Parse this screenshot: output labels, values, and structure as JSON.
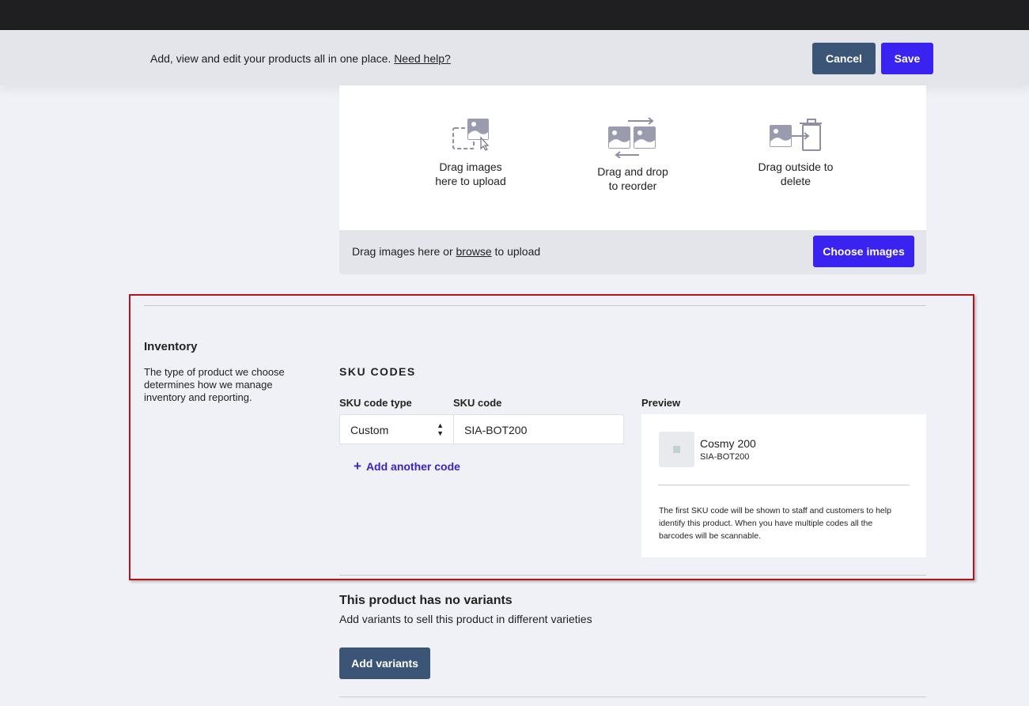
{
  "header": {
    "description": "Add, view and edit your products all in one place.",
    "help_link": "Need help?",
    "cancel_label": "Cancel",
    "save_label": "Save"
  },
  "upload": {
    "items": [
      {
        "icon": "upload-image-icon",
        "line1": "Drag images",
        "line2": "here to upload"
      },
      {
        "icon": "reorder-images-icon",
        "line1": "Drag and drop",
        "line2": "to reorder"
      },
      {
        "icon": "delete-image-icon",
        "line1": "Drag outside to",
        "line2": "delete"
      }
    ],
    "footer_prefix": "Drag images here or",
    "footer_link": "browse",
    "footer_suffix": "to upload",
    "choose_label": "Choose images"
  },
  "inventory": {
    "title": "Inventory",
    "description": "The type of product we choose determines how we manage inventory and reporting."
  },
  "sku": {
    "heading": "SKU CODES",
    "type_label": "SKU code type",
    "code_label": "SKU code",
    "type_value": "Custom",
    "code_value": "SIA-BOT200",
    "add_another_label": "Add another code"
  },
  "preview": {
    "label": "Preview",
    "product_name": "Cosmy 200",
    "product_sku": "SIA-BOT200",
    "note": "The first SKU code will be shown to staff and customers to help identify this product. When you have multiple codes all the barcodes will be scannable."
  },
  "variants": {
    "title": "This product has no variants",
    "description": "Add variants to sell this product in different varieties",
    "button_label": "Add variants"
  },
  "colors": {
    "primary": "#3a22f0",
    "secondary": "#3b5577",
    "highlight": "#b3151b"
  }
}
